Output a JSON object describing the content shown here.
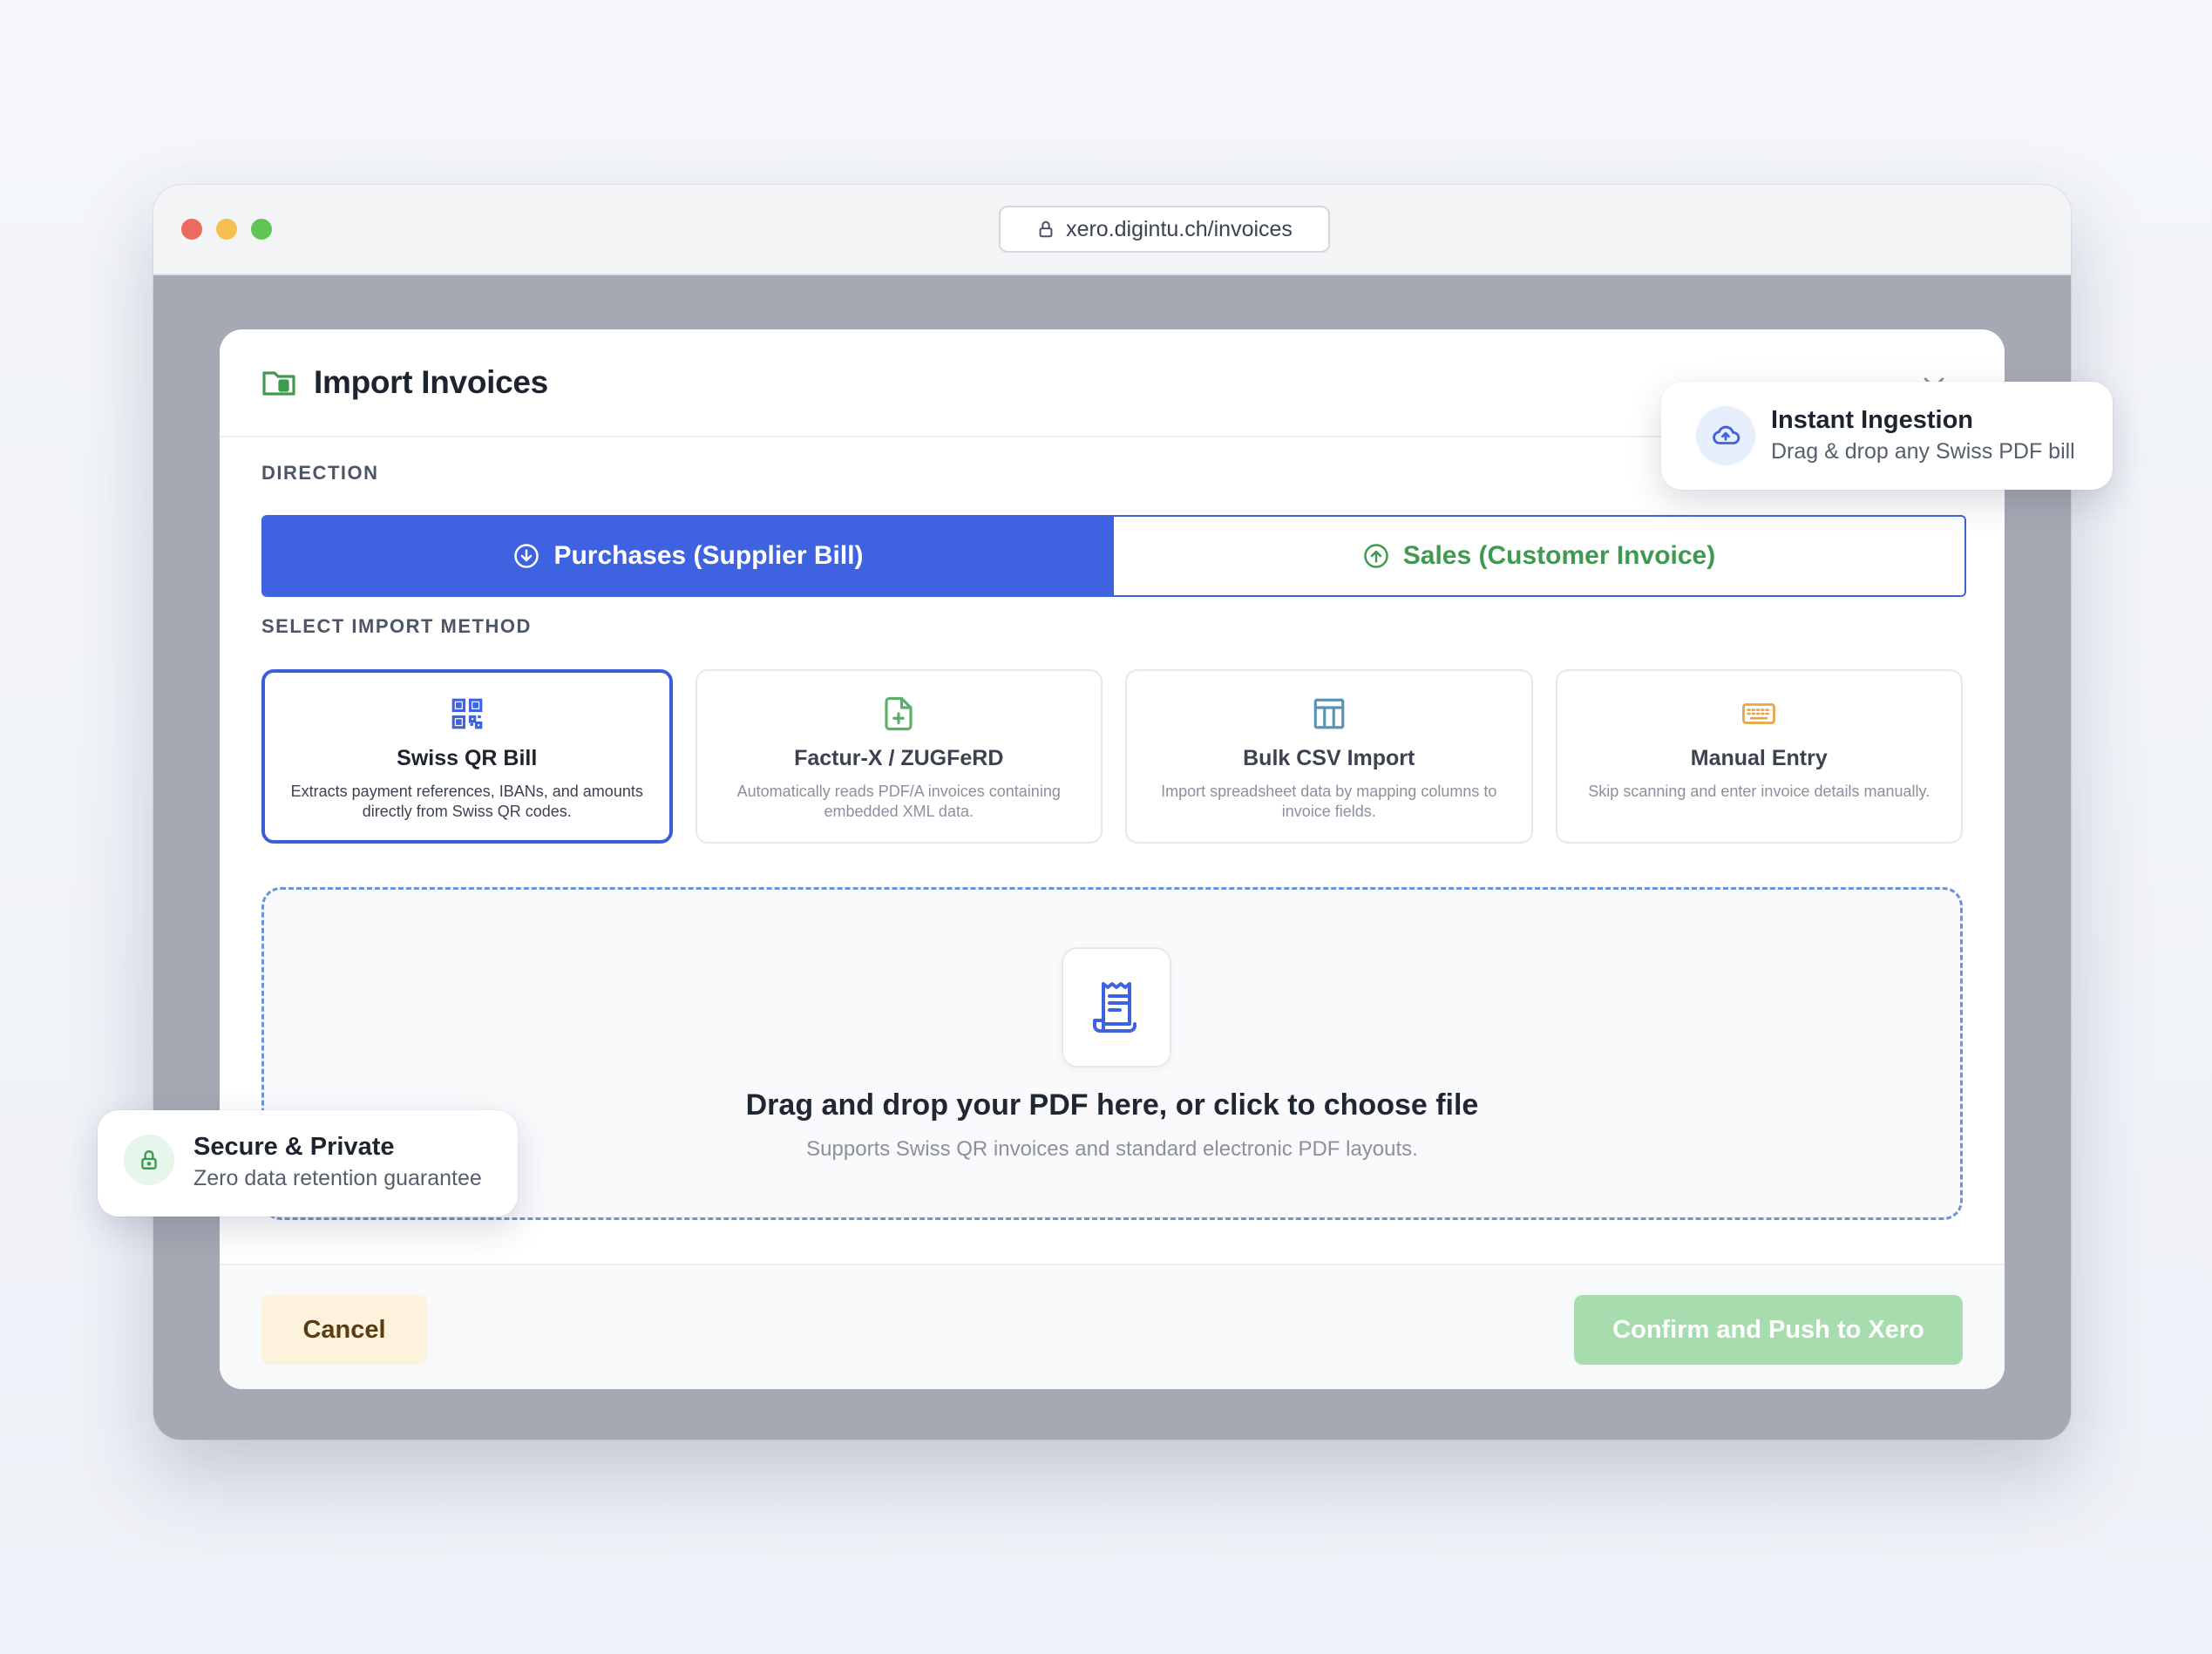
{
  "browser": {
    "url": "xero.digintu.ch/invoices"
  },
  "modal": {
    "title": "Import Invoices",
    "direction_label": "DIRECTION",
    "direction_options": [
      {
        "label": "Purchases (Supplier Bill)",
        "selected": true
      },
      {
        "label": "Sales (Customer Invoice)",
        "selected": false
      }
    ],
    "method_label": "SELECT IMPORT METHOD",
    "methods": [
      {
        "title": "Swiss QR Bill",
        "description": "Extracts payment references, IBANs, and amounts directly from Swiss QR codes.",
        "icon": "qr-code-icon",
        "selected": true
      },
      {
        "title": "Factur-X / ZUGFeRD",
        "description": "Automatically reads PDF/A invoices containing embedded XML data.",
        "icon": "file-plus-icon",
        "selected": false
      },
      {
        "title": "Bulk CSV Import",
        "description": "Import spreadsheet data by mapping columns to invoice fields.",
        "icon": "table-icon",
        "selected": false
      },
      {
        "title": "Manual Entry",
        "description": "Skip scanning and enter invoice details manually.",
        "icon": "keyboard-icon",
        "selected": false
      }
    ],
    "dropzone": {
      "title": "Drag and drop your PDF here, or click to choose file",
      "subtitle": "Supports Swiss QR invoices and standard electronic PDF layouts.",
      "icon": "receipt-icon"
    },
    "footer": {
      "cancel_label": "Cancel",
      "confirm_label": "Confirm and Push to Xero"
    }
  },
  "badges": {
    "instant": {
      "title": "Instant Ingestion",
      "subtitle": "Drag & drop any Swiss PDF bill",
      "icon": "cloud-upload-icon"
    },
    "secure": {
      "title": "Secure & Private",
      "subtitle": "Zero data retention guarantee",
      "icon": "lock-icon"
    }
  },
  "colors": {
    "primary_blue": "#3f63e0",
    "sales_green": "#3f9a4f",
    "confirm_green_disabled": "#a7dcae",
    "cancel_bg": "#fdf3dd",
    "dropzone_border": "#6c95d8"
  }
}
